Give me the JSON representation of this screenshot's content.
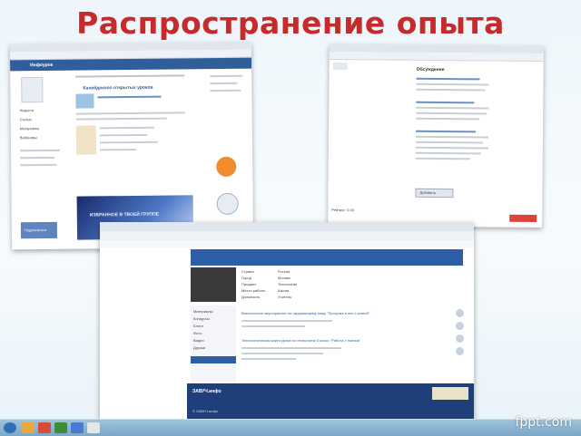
{
  "title": "Распространение опыта",
  "shot1": {
    "logo": "Инфоурок",
    "heading": "Калейдоскоп открытых уроков",
    "sidebar_items": [
      "Новости",
      "Статьи",
      "Материалы",
      "Вебинары"
    ],
    "banner_text": "ИЗБРАННОЕ В ТВОЕЙ ГРУППЕ",
    "button_label": "Подписаться"
  },
  "shot2": {
    "header": "Обсуждение",
    "button_label": "Добавить",
    "footer": "Рейтинг: 0.00"
  },
  "shot3": {
    "site_logo": "ЗАВУЧ.инфо",
    "profile_rows": [
      "Страна",
      "Город",
      "Предмет",
      "Место работы",
      "Должность"
    ],
    "profile_values": [
      "Россия",
      "Москва",
      "Технология",
      "Школа",
      "Учитель"
    ],
    "left_menu": [
      "Материалы",
      "Конкурсы",
      "Блоги",
      "Фото",
      "Видео",
      "Друзья"
    ],
    "post1_title": "Внеклассное мероприятие по окружающему миру \"Прогулка в лес с книгой\"",
    "post2_title": "Технологическая карта урока по технологии 5 класс \"Работа с тканью\"",
    "footer_note": "© ЗАВУЧ.инфо"
  },
  "watermark": "fppt.com"
}
